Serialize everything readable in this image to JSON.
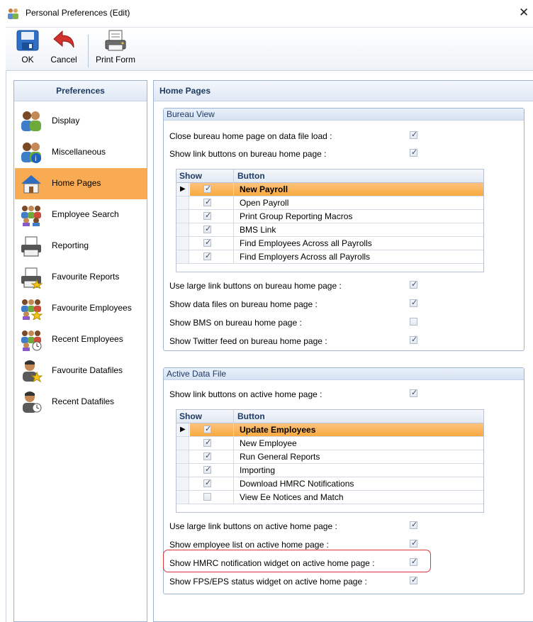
{
  "window": {
    "title": "Personal Preferences (Edit)",
    "close_label": "✕"
  },
  "toolbar": {
    "ok_label": "OK",
    "cancel_label": "Cancel",
    "print_label": "Print Form"
  },
  "sidebar": {
    "header": "Preferences",
    "items": [
      {
        "label": "Display",
        "icon": "users-icon"
      },
      {
        "label": "Miscellaneous",
        "icon": "users-info-icon"
      },
      {
        "label": "Home Pages",
        "icon": "house-icon",
        "active": true
      },
      {
        "label": "Employee Search",
        "icon": "employee-search-icon"
      },
      {
        "label": "Reporting",
        "icon": "printer-icon"
      },
      {
        "label": "Favourite Reports",
        "icon": "report-star-icon"
      },
      {
        "label": "Favourite Employees",
        "icon": "group-star-icon"
      },
      {
        "label": "Recent Employees",
        "icon": "group-clock-icon"
      },
      {
        "label": "Favourite Datafiles",
        "icon": "user-star-icon"
      },
      {
        "label": "Recent Datafiles",
        "icon": "user-clock-icon"
      }
    ]
  },
  "main": {
    "header": "Home Pages",
    "bureau": {
      "title": "Bureau View",
      "options_top": [
        {
          "label": "Close bureau home page on data file load :",
          "checked": true
        },
        {
          "label": "Show link buttons on bureau home page :",
          "checked": true
        }
      ],
      "grid_headers": {
        "show": "Show",
        "button": "Button"
      },
      "rows": [
        {
          "label": "New Payroll",
          "checked": true,
          "current": true
        },
        {
          "label": "Open Payroll",
          "checked": true
        },
        {
          "label": "Print Group Reporting Macros",
          "checked": true
        },
        {
          "label": "BMS Link",
          "checked": true
        },
        {
          "label": "Find Employees Across all Payrolls",
          "checked": true
        },
        {
          "label": "Find Employers Across all Payrolls",
          "checked": true
        }
      ],
      "options_bottom": [
        {
          "label": "Use large link buttons on bureau home page :",
          "checked": true
        },
        {
          "label": "Show data files on bureau home page :",
          "checked": true
        },
        {
          "label": "Show BMS on bureau home page :",
          "checked": false
        },
        {
          "label": "Show Twitter feed on bureau home page :",
          "checked": true
        }
      ]
    },
    "active": {
      "title": "Active Data File",
      "options_top": [
        {
          "label": "Show link buttons on active home page :",
          "checked": true
        }
      ],
      "grid_headers": {
        "show": "Show",
        "button": "Button"
      },
      "rows": [
        {
          "label": "Update Employees",
          "checked": true,
          "current": true
        },
        {
          "label": "New Employee",
          "checked": true
        },
        {
          "label": "Run General Reports",
          "checked": true
        },
        {
          "label": "Importing",
          "checked": true
        },
        {
          "label": "Download HMRC Notifications",
          "checked": true
        },
        {
          "label": "View Ee Notices and Match",
          "checked": false
        }
      ],
      "options_bottom": [
        {
          "label": "Use large link buttons on active home page :",
          "checked": true
        },
        {
          "label": "Show employee list on active home page :",
          "checked": true
        },
        {
          "label": "Show HMRC notification widget on active home page :",
          "checked": true
        },
        {
          "label": "Show FPS/EPS status widget on active home page :",
          "checked": true
        }
      ]
    }
  },
  "colors": {
    "active_item": "#f9ab53",
    "highlight_border": "#d9363e",
    "panel_border": "#9fb4d2"
  }
}
